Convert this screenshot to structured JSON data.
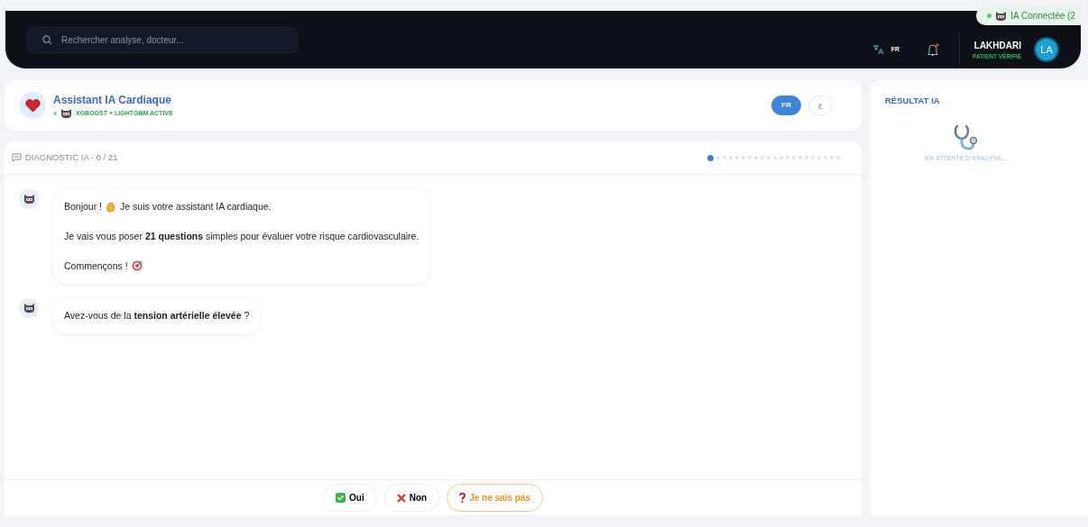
{
  "header": {
    "search": {
      "placeholder": "Rechercher analyse, docteur..."
    },
    "language": "FR",
    "notification_unread": true,
    "user": {
      "name": "LAKHDARI",
      "status": "PATIENT VÉRIFIÉ",
      "initials": "LA"
    },
    "connection": {
      "label": "IA Connectée (2",
      "online": true
    }
  },
  "assistant": {
    "title": "Assistant IA Cardiaque",
    "subtitle": "XGBOOST + LIGHTGBM ACTIVE",
    "languages": [
      {
        "label": "FR",
        "selected": true
      },
      {
        "label": "ع",
        "selected": false
      }
    ]
  },
  "chat": {
    "title": "DIAGNOSTIC IA - 0 / 21",
    "progress": [
      {
        "selected": true
      },
      {
        "selected": false
      },
      {
        "selected": false
      },
      {
        "selected": false
      },
      {
        "selected": false
      },
      {
        "selected": false
      },
      {
        "selected": false
      },
      {
        "selected": false
      },
      {
        "selected": false
      },
      {
        "selected": false
      },
      {
        "selected": false
      },
      {
        "selected": false
      },
      {
        "selected": false
      },
      {
        "selected": false
      },
      {
        "selected": false
      },
      {
        "selected": false
      },
      {
        "selected": false
      },
      {
        "selected": false
      },
      {
        "selected": false
      },
      {
        "selected": false
      },
      {
        "selected": false
      }
    ],
    "messages": [
      {
        "lines": [
          {
            "kind": "greeting",
            "text": "Bonjour !",
            "after": "Je suis votre assistant IA cardiaque."
          },
          {
            "kind": "plain",
            "text": "Je vais vous poser **21 questions** simples pour évaluer votre risque cardiovasculaire."
          },
          {
            "kind": "start",
            "text": "Commençons !"
          }
        ]
      },
      {
        "lines": [
          {
            "kind": "plain",
            "text": "Avez-vous de la **tension artérielle élevée** ?"
          }
        ]
      }
    ],
    "answers": [
      {
        "kind": "yes",
        "label": "Oui"
      },
      {
        "kind": "no",
        "label": "Non"
      },
      {
        "kind": "unknown",
        "label": "Je ne sais pas"
      }
    ]
  },
  "result": {
    "title": "RÉSULTAT IA",
    "status": "EN ATTENTE D'ANALYSE..."
  }
}
